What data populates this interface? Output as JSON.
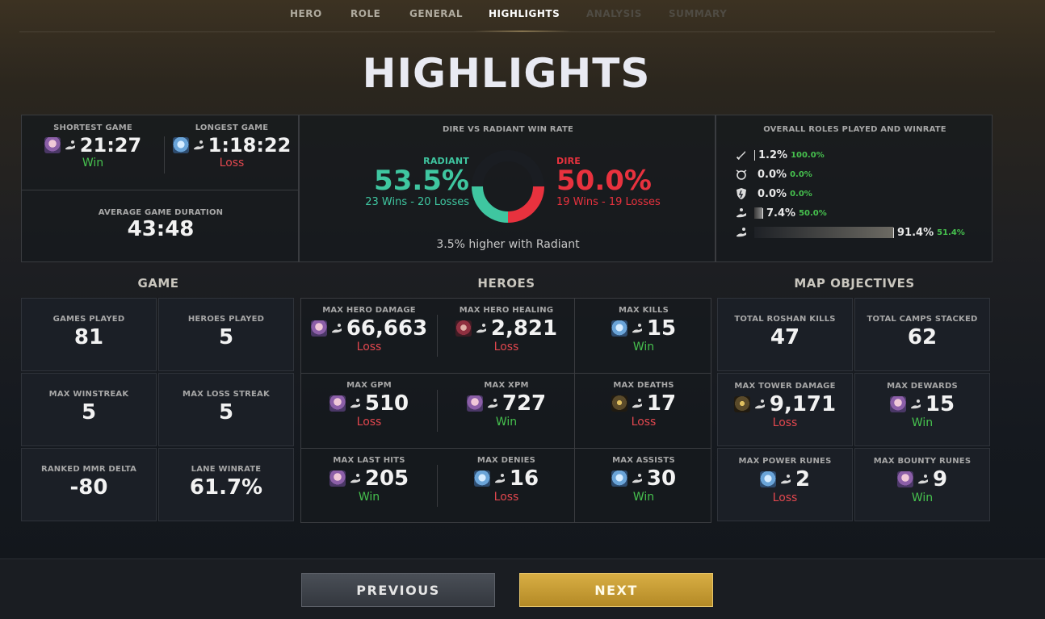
{
  "nav": {
    "tabs": [
      "HERO",
      "ROLE",
      "GENERAL",
      "HIGHLIGHTS",
      "ANALYSIS",
      "SUMMARY"
    ],
    "active": "HIGHLIGHTS"
  },
  "page_title": "HIGHLIGHTS",
  "duration": {
    "shortest": {
      "label": "SHORTEST GAME",
      "value": "21:27",
      "result": "Win",
      "hero_icon": "crystal-maiden-icon"
    },
    "longest": {
      "label": "LONGEST GAME",
      "value": "1:18:22",
      "result": "Loss",
      "hero_icon": "ancient-apparition-icon"
    },
    "average": {
      "label": "AVERAGE GAME DURATION",
      "value": "43:48"
    }
  },
  "winrate": {
    "title": "DIRE VS RADIANT WIN RATE",
    "radiant": {
      "label": "RADIANT",
      "pct": "53.5%",
      "record": "23 Wins - 20 Losses",
      "wins": 23,
      "losses": 20
    },
    "dire": {
      "label": "DIRE",
      "pct": "50.0%",
      "record": "19 Wins - 19 Losses",
      "wins": 19,
      "losses": 19
    },
    "footer": "3.5% higher with Radiant"
  },
  "roles": {
    "title": "OVERALL ROLES PLAYED AND WINRATE",
    "items": [
      {
        "icon": "carry-sword-icon",
        "pct": "1.2%",
        "wr": "100.0%",
        "share": 1.2
      },
      {
        "icon": "mid-icon",
        "pct": "0.0%",
        "wr": "0.0%",
        "share": 0.0
      },
      {
        "icon": "offlane-shield-icon",
        "pct": "0.0%",
        "wr": "0.0%",
        "share": 0.0
      },
      {
        "icon": "soft-support-icon",
        "pct": "7.4%",
        "wr": "50.0%",
        "share": 7.4
      },
      {
        "icon": "hard-support-icon",
        "pct": "91.4%",
        "wr": "51.4%",
        "share": 91.4
      }
    ]
  },
  "sections": {
    "game": "GAME",
    "heroes": "HEROES",
    "map": "MAP OBJECTIVES"
  },
  "game": [
    {
      "label": "GAMES PLAYED",
      "value": "81"
    },
    {
      "label": "HEROES PLAYED",
      "value": "5"
    },
    {
      "label": "MAX WINSTREAK",
      "value": "5"
    },
    {
      "label": "MAX LOSS STREAK",
      "value": "5"
    },
    {
      "label": "RANKED MMR DELTA",
      "value": "-80"
    },
    {
      "label": "LANE WINRATE",
      "value": "61.7%"
    }
  ],
  "heroes": [
    {
      "label": "MAX HERO DAMAGE",
      "value": "66,663",
      "result": "Loss",
      "hero": "crystal"
    },
    {
      "label": "MAX HERO HEALING",
      "value": "2,821",
      "result": "Loss",
      "hero": "pudge"
    },
    {
      "label": "MAX KILLS",
      "value": "15",
      "result": "Win",
      "hero": "ancient"
    },
    {
      "label": "MAX GPM",
      "value": "510",
      "result": "Loss",
      "hero": "crystal"
    },
    {
      "label": "MAX XPM",
      "value": "727",
      "result": "Win",
      "hero": "crystal"
    },
    {
      "label": "MAX DEATHS",
      "value": "17",
      "result": "Loss",
      "hero": "shadow"
    },
    {
      "label": "MAX LAST HITS",
      "value": "205",
      "result": "Win",
      "hero": "crystal"
    },
    {
      "label": "MAX DENIES",
      "value": "16",
      "result": "Loss",
      "hero": "ancient"
    },
    {
      "label": "MAX ASSISTS",
      "value": "30",
      "result": "Win",
      "hero": "ancient"
    }
  ],
  "map": [
    {
      "label": "TOTAL ROSHAN KILLS",
      "value": "47"
    },
    {
      "label": "TOTAL CAMPS STACKED",
      "value": "62"
    },
    {
      "label": "MAX TOWER DAMAGE",
      "value": "9,171",
      "result": "Loss",
      "hero": "shadow"
    },
    {
      "label": "MAX DEWARDS",
      "value": "15",
      "result": "Win",
      "hero": "crystal"
    },
    {
      "label": "MAX POWER RUNES",
      "value": "2",
      "result": "Loss",
      "hero": "ancient"
    },
    {
      "label": "MAX BOUNTY RUNES",
      "value": "9",
      "result": "Win",
      "hero": "crystal"
    }
  ],
  "buttons": {
    "previous": "PREVIOUS",
    "next": "NEXT"
  },
  "colors": {
    "radiant": "#3fc6a0",
    "dire": "#e8323e",
    "win": "#46c14e",
    "loss": "#e0474e",
    "accent": "#c8aa6e"
  }
}
